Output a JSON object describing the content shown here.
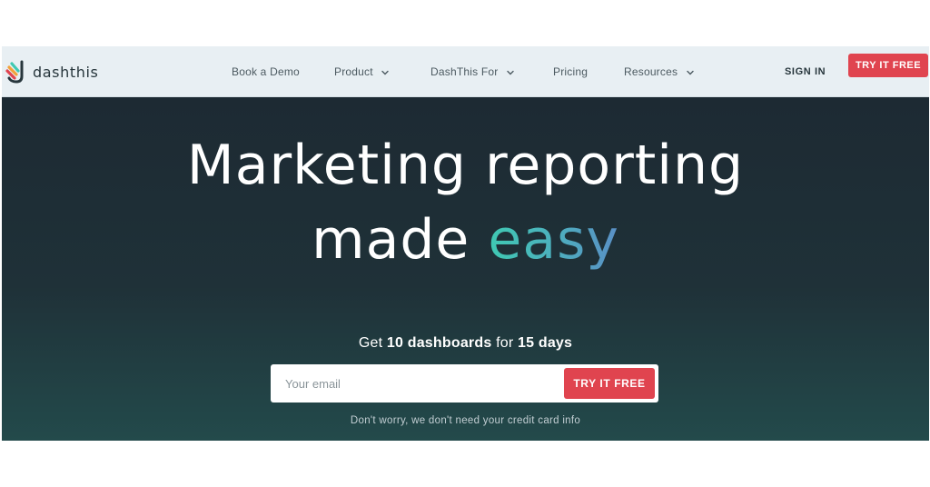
{
  "brand": {
    "name": "dashthis",
    "colors": {
      "cta": "#e0444f",
      "accent_start": "#3fc9b2",
      "accent_end": "#5a8fc6",
      "hero_bg": "#1f3138"
    }
  },
  "nav": {
    "links": [
      {
        "label": "Book a Demo",
        "has_dropdown": false
      },
      {
        "label": "Product",
        "has_dropdown": true
      },
      {
        "label": "DashThis For",
        "has_dropdown": true
      },
      {
        "label": "Pricing",
        "has_dropdown": false
      },
      {
        "label": "Resources",
        "has_dropdown": true
      }
    ],
    "sign_in": "SIGN IN",
    "cta": "TRY IT FREE"
  },
  "hero": {
    "headline_line1": "Marketing reporting",
    "headline_line2_lead": "made",
    "headline_line2_accent": "easy",
    "offer": {
      "prefix": "Get",
      "dashboards": "10 dashboards",
      "middle": "for",
      "days": "15 days"
    },
    "email_placeholder": "Your email",
    "cta": "TRY IT FREE",
    "note": "Don't worry, we don't need your credit card info"
  },
  "icons": {
    "logo": "dashthis-logo-icon",
    "dropdown": "chevron-down-icon"
  }
}
